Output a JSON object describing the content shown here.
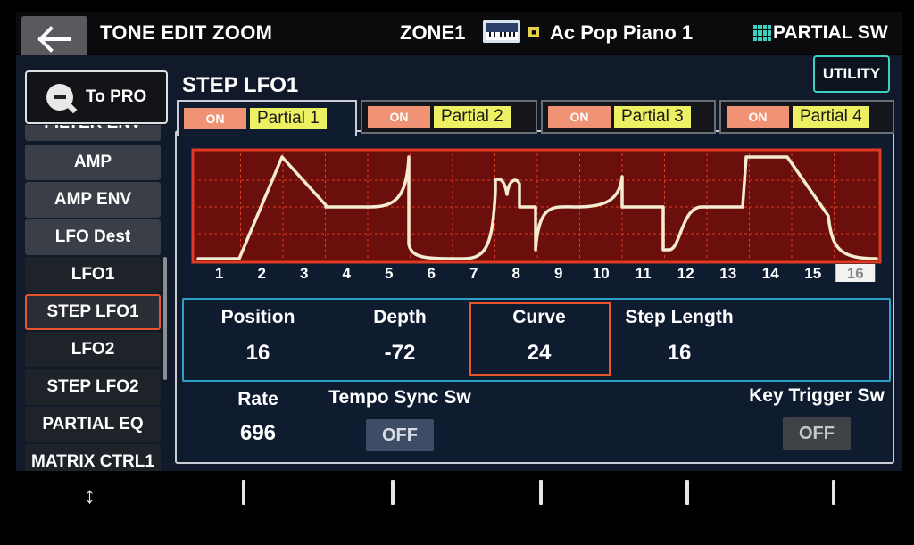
{
  "header": {
    "title": "TONE EDIT ZOOM",
    "zone": "ZONE1",
    "tone_name": "Ac Pop Piano 1",
    "partial_sw": "PARTIAL SW"
  },
  "sidebar": {
    "to_pro": "To PRO",
    "items": [
      {
        "label": "FILTER ENV"
      },
      {
        "label": "AMP"
      },
      {
        "label": "AMP ENV"
      },
      {
        "label": "LFO Dest"
      },
      {
        "label": "LFO1"
      },
      {
        "label": "STEP LFO1"
      },
      {
        "label": "LFO2"
      },
      {
        "label": "STEP LFO2"
      },
      {
        "label": "PARTIAL EQ"
      },
      {
        "label": "MATRIX CTRL1"
      }
    ],
    "active_index": 5
  },
  "utility_label": "UTILITY",
  "section_title": "STEP LFO1",
  "partials": [
    {
      "on": "ON",
      "name": "Partial 1"
    },
    {
      "on": "ON",
      "name": "Partial 2"
    },
    {
      "on": "ON",
      "name": "Partial 3"
    },
    {
      "on": "ON",
      "name": "Partial 4"
    }
  ],
  "selected_partial": 0,
  "step_graph": {
    "steps": [
      "1",
      "2",
      "3",
      "4",
      "5",
      "6",
      "7",
      "8",
      "9",
      "10",
      "11",
      "12",
      "13",
      "14",
      "15",
      "16"
    ],
    "selected_step": 16
  },
  "params": {
    "position": {
      "label": "Position",
      "value": "16"
    },
    "depth": {
      "label": "Depth",
      "value": "-72"
    },
    "curve": {
      "label": "Curve",
      "value": "24"
    },
    "step_length": {
      "label": "Step Length",
      "value": "16"
    },
    "rate": {
      "label": "Rate",
      "value": "696"
    },
    "tempo_sync": {
      "label": "Tempo Sync Sw",
      "value": "OFF"
    },
    "key_trigger": {
      "label": "Key Trigger Sw",
      "value": "OFF"
    }
  },
  "colors": {
    "accent_orange": "#e8552a",
    "accent_teal": "#3ed0c0",
    "graph_bg": "#6a0f0c",
    "graph_border": "#e03a22",
    "on_badge": "#f09274",
    "partial_badge": "#ecf062"
  }
}
